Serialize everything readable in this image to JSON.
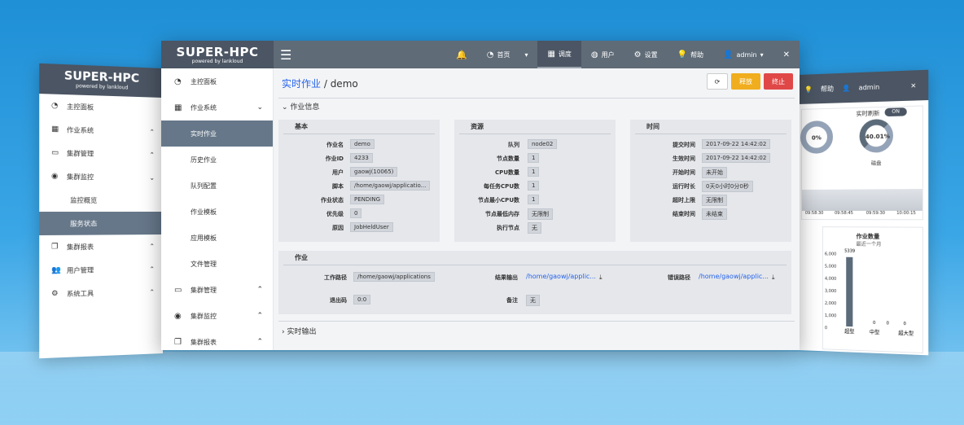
{
  "left_panel": {
    "brand": "SUPER-HPC",
    "brand_sub": "powered by lankloud",
    "items": [
      {
        "label": "主控面板",
        "icon": "dashboard-icon"
      },
      {
        "label": "作业系统",
        "icon": "calendar-icon"
      },
      {
        "label": "集群管理",
        "icon": "monitor-icon"
      },
      {
        "label": "集群监控",
        "icon": "eye-icon"
      }
    ],
    "subs": [
      "监控概览",
      "服务状态"
    ],
    "items2": [
      {
        "label": "集群报表",
        "icon": "report-icon"
      },
      {
        "label": "用户管理",
        "icon": "users-icon"
      },
      {
        "label": "系统工具",
        "icon": "tools-icon"
      }
    ]
  },
  "right_panel": {
    "top": [
      "帮助",
      "admin"
    ],
    "toggle_label": "实时刷新",
    "toggle_state": "ON",
    "donut1": "0%",
    "donut2": "40.01%",
    "donut2_label": "磁盘",
    "chart_times": [
      "09:58:30",
      "09:58:45",
      "09:59:30",
      "10:00:15"
    ],
    "chart2_title": "作业数量",
    "chart2_sub": "最近一个月",
    "y_ticks": [
      "6,000",
      "5,000",
      "4,000",
      "3,000",
      "2,000",
      "1,000",
      "0"
    ],
    "bar_label": "5339",
    "bar_values": [
      "0",
      "0",
      "0"
    ],
    "x_labels": [
      "超型",
      "中型",
      "超大型"
    ]
  },
  "topbar": {
    "brand": "SUPER-HPC",
    "brand_sub": "powered by lankloud",
    "nav": [
      {
        "label": "首页",
        "icon": "gauge-icon",
        "dropdown": true
      },
      {
        "label": "调度",
        "icon": "calendar-icon",
        "active": true
      },
      {
        "label": "用户",
        "icon": "user-circle-icon"
      },
      {
        "label": "设置",
        "icon": "gear-icon"
      },
      {
        "label": "帮助",
        "icon": "lightbulb-icon"
      },
      {
        "label": "admin",
        "icon": "user-icon",
        "dropdown": true
      }
    ]
  },
  "sidebar": {
    "items": [
      {
        "label": "主控面板",
        "icon": "dashboard-icon"
      },
      {
        "label": "作业系统",
        "icon": "calendar-icon",
        "chevron": "down"
      }
    ],
    "subs": [
      {
        "label": "实时作业",
        "active": true
      },
      {
        "label": "历史作业"
      },
      {
        "label": "队列配置"
      },
      {
        "label": "作业模板"
      },
      {
        "label": "应用模板"
      },
      {
        "label": "文件管理"
      }
    ],
    "items2": [
      {
        "label": "集群管理",
        "icon": "monitor-icon"
      },
      {
        "label": "集群监控",
        "icon": "eye-icon"
      },
      {
        "label": "集群报表",
        "icon": "report-icon"
      }
    ]
  },
  "page": {
    "breadcrumb_link": "实时作业",
    "breadcrumb_sep": " / ",
    "breadcrumb_current": "demo",
    "btn_release": "释放",
    "btn_stop": "终止",
    "section_info": "作业信息",
    "section_output": "实时输出"
  },
  "basic": {
    "title": "基本",
    "rows": [
      {
        "k": "作业名",
        "v": "demo"
      },
      {
        "k": "作业ID",
        "v": "4233"
      },
      {
        "k": "用户",
        "v": "gaowj(10065)"
      },
      {
        "k": "脚本",
        "v": "/home/gaowj/applicatio..."
      },
      {
        "k": "作业状态",
        "v": "PENDING"
      },
      {
        "k": "优先级",
        "v": "0"
      },
      {
        "k": "原因",
        "v": "JobHeldUser"
      }
    ]
  },
  "resource": {
    "title": "资源",
    "rows": [
      {
        "k": "队列",
        "v": "node02"
      },
      {
        "k": "节点数量",
        "v": "1"
      },
      {
        "k": "CPU数量",
        "v": "1"
      },
      {
        "k": "每任务CPU数",
        "v": "1"
      },
      {
        "k": "节点最小CPU数",
        "v": "1"
      },
      {
        "k": "节点最低内存",
        "v": "无限制"
      },
      {
        "k": "执行节点",
        "v": "无"
      }
    ]
  },
  "time": {
    "title": "时间",
    "rows": [
      {
        "k": "提交时间",
        "v": "2017-09-22 14:42:02"
      },
      {
        "k": "生效时间",
        "v": "2017-09-22 14:42:02"
      },
      {
        "k": "开始时间",
        "v": "未开始"
      },
      {
        "k": "运行时长",
        "v": "0天0小时0分0秒"
      },
      {
        "k": "超时上限",
        "v": "无限制"
      },
      {
        "k": "结束时间",
        "v": "未结束"
      }
    ]
  },
  "job": {
    "title": "作业",
    "workdir_k": "工作路径",
    "workdir_v": "/home/gaowj/applications",
    "out_k": "结果输出",
    "out_v": "/home/gaowj/applic...",
    "err_k": "错误路径",
    "err_v": "/home/gaowj/applic...",
    "exit_k": "退出码",
    "exit_v": "0:0",
    "note_k": "备注",
    "note_v": "无"
  }
}
